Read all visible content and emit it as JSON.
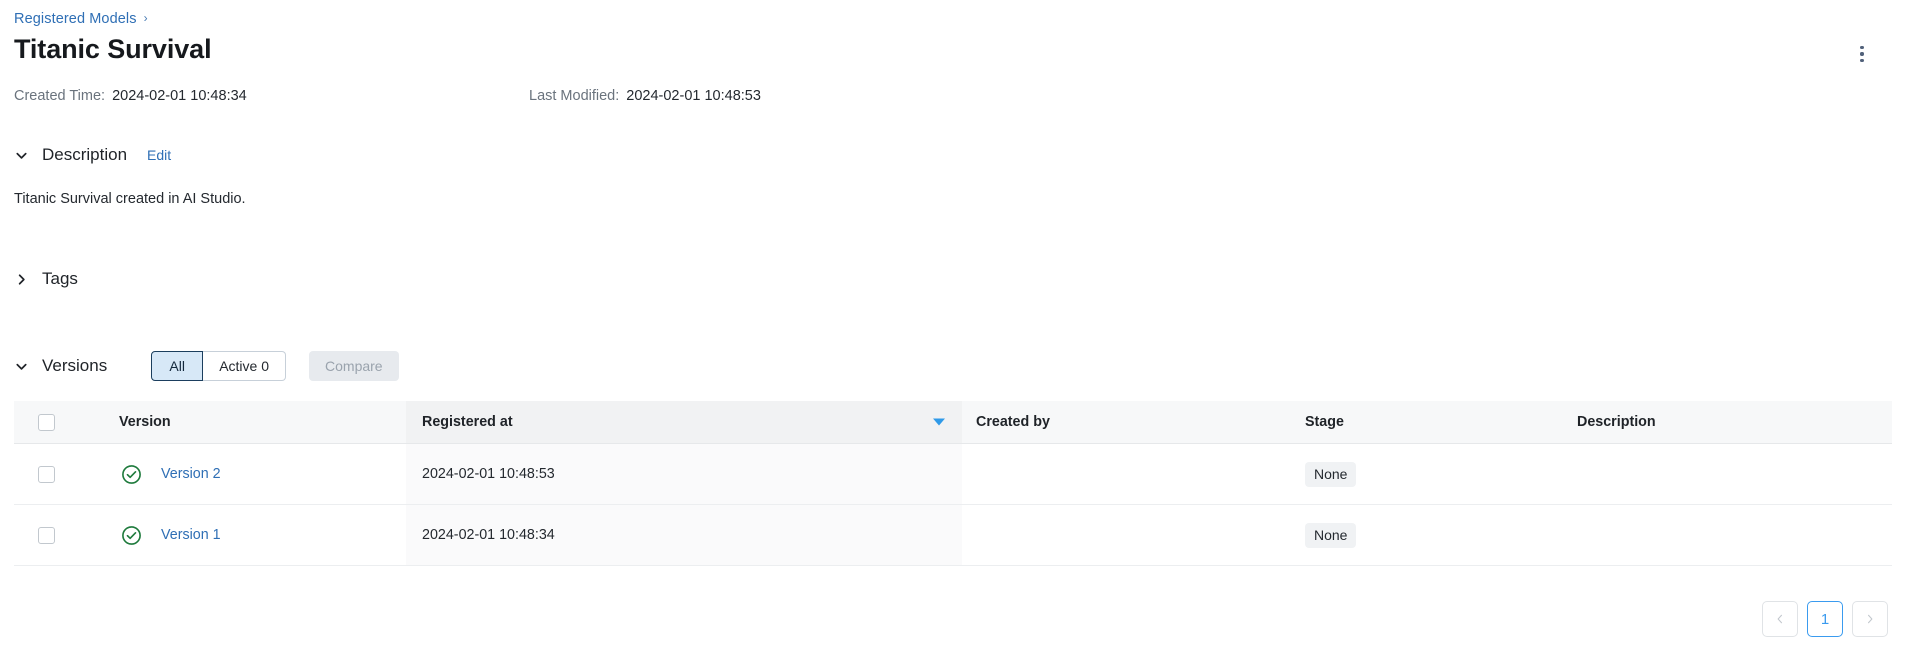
{
  "breadcrumb": {
    "link_label": "Registered Models",
    "separator": "›"
  },
  "header": {
    "title": "Titanic Survival",
    "menu_icon": "kebab-menu-icon"
  },
  "meta": {
    "created_label": "Created Time:",
    "created_value": "2024-02-01 10:48:34",
    "modified_label": "Last Modified:",
    "modified_value": "2024-02-01 10:48:53"
  },
  "description_section": {
    "title": "Description",
    "edit_label": "Edit",
    "body": "Titanic Survival created in AI Studio.",
    "expanded": true
  },
  "tags_section": {
    "title": "Tags",
    "expanded": false
  },
  "versions_section": {
    "title": "Versions",
    "filter_all_label": "All",
    "filter_active_label": "Active 0",
    "compare_label": "Compare",
    "active_filter": "All",
    "columns": [
      "Version",
      "Registered at",
      "Created by",
      "Stage",
      "Description"
    ],
    "sorted_column": "Registered at",
    "sort_direction": "desc",
    "rows": [
      {
        "version_label": "Version 2",
        "status_icon": "check-circle-icon",
        "registered_at": "2024-02-01 10:48:53",
        "created_by": "",
        "stage": "None",
        "description": "",
        "checked": false
      },
      {
        "version_label": "Version 1",
        "status_icon": "check-circle-icon",
        "registered_at": "2024-02-01 10:48:34",
        "created_by": "",
        "stage": "None",
        "description": "",
        "checked": false
      }
    ]
  },
  "pagination": {
    "prev_label": "‹",
    "next_label": "›",
    "current_page": "1"
  },
  "colors": {
    "link": "#2f6fb5",
    "accent_blue": "#3a9bef",
    "sort_caret": "#2f9ae8",
    "status_green": "#1e7a3c",
    "segment_active_bg": "#d7e8f7",
    "segment_active_border": "#1b3e5e",
    "disabled_button_bg": "#e7eaee",
    "disabled_button_text": "#9aa3ad",
    "table_header_bg": "#f7f8f9",
    "sorted_column_bg": "#fafafb"
  }
}
